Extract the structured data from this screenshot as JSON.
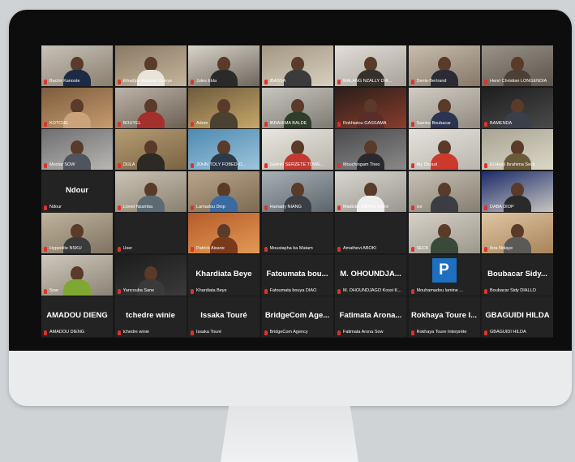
{
  "participants": [
    {
      "name": "Bachir Kanoute",
      "mode": "video",
      "bg": [
        "#c7c2b8",
        "#8a7f70"
      ],
      "shirt": "#1d2a44"
    },
    {
      "name": "Elhadjon Rassoul Gueye",
      "mode": "video",
      "bg": [
        "#8b7a63",
        "#c4b59d"
      ],
      "shirt": "#e8e4dc"
    },
    {
      "name": "Jules Ekla",
      "mode": "video",
      "bg": [
        "#d9d4cb",
        "#6e665c"
      ],
      "shirt": "#2a2a2a"
    },
    {
      "name": "IBASSA",
      "mode": "video",
      "bg": [
        "#a39784",
        "#d8cfbf"
      ],
      "shirt": "#3b3b3b"
    },
    {
      "name": "MALANG NZALLY DIA...",
      "mode": "video",
      "bg": [
        "#e2ded8",
        "#a8a29a"
      ],
      "shirt": "#35302b"
    },
    {
      "name": "Denis-Bertrand",
      "mode": "video",
      "bg": [
        "#c9bdae",
        "#857867"
      ],
      "shirt": "#2b2b33"
    },
    {
      "name": "Henri Christian LONGENDIA",
      "mode": "video",
      "bg": [
        "#9a9389",
        "#5b544c"
      ],
      "shirt": "#4a4036"
    },
    {
      "name": "KOTCHE",
      "mode": "video",
      "bg": [
        "#7d5c3d",
        "#c79c70"
      ],
      "shirt": "#caa37a"
    },
    {
      "name": "BOUYEL",
      "mode": "video",
      "bg": [
        "#bdb3a8",
        "#6b5f52"
      ],
      "shirt": "#a3302c"
    },
    {
      "name": "Adom",
      "mode": "video",
      "bg": [
        "#6e5b3f",
        "#c7a869"
      ],
      "shirt": "#4b4130"
    },
    {
      "name": "IBRAHIMA BALDE",
      "mode": "video",
      "bg": [
        "#c8c6c0",
        "#7d7a72"
      ],
      "shirt": "#2f3d2a"
    },
    {
      "name": "Rokhiatou GASSAMA",
      "mode": "video",
      "bg": [
        "#2a1e1a",
        "#8a3d2c"
      ],
      "shirt": "#5a2c2a"
    },
    {
      "name": "Samira Boubacar",
      "mode": "video",
      "bg": [
        "#d2cdc4",
        "#908a80"
      ],
      "shirt": "#2b3450"
    },
    {
      "name": "BAMENDA",
      "mode": "video",
      "bg": [
        "#1e1e1e",
        "#4a4a4a"
      ],
      "shirt": "#3a3f4a"
    },
    {
      "name": "Moctar SOW",
      "mode": "video",
      "bg": [
        "#6e6e72",
        "#b9b7b2"
      ],
      "shirt": "#50545c"
    },
    {
      "name": "OULA",
      "mode": "video",
      "bg": [
        "#b59c73",
        "#7a6342"
      ],
      "shirt": "#2d2a26"
    },
    {
      "name": "JOHN TOLY FOBED-O...",
      "mode": "video",
      "bg": [
        "#4d8ab0",
        "#9fc4dc"
      ],
      "shirt": "#2c3a4a"
    },
    {
      "name": "Gabriel SERZETE TOWE...",
      "mode": "video",
      "bg": [
        "#e8e6e0",
        "#b8b4aa"
      ],
      "shirt": "#c23a30"
    },
    {
      "name": "Mouchingam Theo",
      "mode": "video",
      "bg": [
        "#4a4a4e",
        "#8b8a88"
      ],
      "shirt": "#2a2a2e"
    },
    {
      "name": "Aly Daoud",
      "mode": "video",
      "bg": [
        "#e4e2dc",
        "#bab6ae"
      ],
      "shirt": "#cc3a2e"
    },
    {
      "name": "El Hadji Ibrahima Seck",
      "mode": "video",
      "bg": [
        "#a8a392",
        "#dcd8c8"
      ],
      "shirt": "#6a5a3a"
    },
    {
      "name": "Ndour",
      "mode": "name"
    },
    {
      "name": "Lionel Nzamba",
      "mode": "video",
      "bg": [
        "#cbc3b5",
        "#8a8070"
      ],
      "shirt": "#5c6a72"
    },
    {
      "name": "Lamadou Diop",
      "mode": "video",
      "bg": [
        "#b9a58a",
        "#7d6a52"
      ],
      "shirt": "#3a6aa0"
    },
    {
      "name": "Hamady NIANG",
      "mode": "video",
      "bg": [
        "#a8b0b6",
        "#5d656c"
      ],
      "shirt": "#3b3f44"
    },
    {
      "name": "Madicke MBAYE maire",
      "mode": "video",
      "bg": [
        "#d8d6d0",
        "#9a968e"
      ],
      "shirt": "#eeeeee"
    },
    {
      "name": "ice",
      "mode": "video",
      "bg": [
        "#c7c2b6",
        "#857e70"
      ],
      "shirt": "#3c3c44"
    },
    {
      "name": "DABA DIOP",
      "mode": "video",
      "bg": [
        "#1b2a6b",
        "#c9c6bf"
      ],
      "shirt": "#2a2a2a"
    },
    {
      "name": "Hyppolite NSKU",
      "mode": "video",
      "bg": [
        "#c1b49e",
        "#7f7260"
      ],
      "shirt": "#3a3a3a"
    },
    {
      "name": "User",
      "mode": "blank"
    },
    {
      "name": "Patrick Aisane",
      "mode": "video",
      "bg": [
        "#b55b2a",
        "#e39a55"
      ],
      "shirt": "#7a3a1a"
    },
    {
      "name": "Moustapha ba Matam",
      "mode": "blank"
    },
    {
      "name": "Amathevi ABOKI",
      "mode": "blank"
    },
    {
      "name": "SECK",
      "mode": "video",
      "bg": [
        "#d6d2c8",
        "#9d978b"
      ],
      "shirt": "#3a4a3a"
    },
    {
      "name": "Ibra Ndiaye",
      "mode": "video",
      "bg": [
        "#e0c6a3",
        "#a7835a"
      ],
      "shirt": "#5b5a56"
    },
    {
      "name": "Sow",
      "mode": "video",
      "bg": [
        "#cfc9bd",
        "#8a8375"
      ],
      "shirt": "#7ea832"
    },
    {
      "name": "Yancouba Sane",
      "mode": "video",
      "bg": [
        "#1c1c1c",
        "#3a3a3a"
      ],
      "shirt": "#3a3a3a"
    },
    {
      "name": "Khardiata Beye",
      "mode": "name"
    },
    {
      "name": "Fatoumata bouya DIAO",
      "display": "Fatoumata bou...",
      "mode": "name"
    },
    {
      "name": "M. OHOUNDJAGO Kossi K...",
      "display": "M. OHOUNDJA...",
      "mode": "name"
    },
    {
      "name": "Mouhamadou lamine ...",
      "mode": "avatar",
      "avatar": "P"
    },
    {
      "name": "Boubacar Sidy DIALLO",
      "display": "Boubacar Sidy...",
      "mode": "name"
    },
    {
      "name": "AMADOU DIENG",
      "mode": "name"
    },
    {
      "name": "tchedre winie",
      "mode": "name"
    },
    {
      "name": "Issaka Touré",
      "mode": "name"
    },
    {
      "name": "BridgeCom Agency",
      "display": "BridgeCom Age...",
      "mode": "name"
    },
    {
      "name": "Fatimata Arona Sow",
      "display": "Fatimata Arona...",
      "mode": "name"
    },
    {
      "name": "Rokhaya Toure Interprète",
      "display": "Rokhaya Toure I...",
      "mode": "name"
    },
    {
      "name": "GBAGUIDI HILDA",
      "mode": "name"
    }
  ]
}
